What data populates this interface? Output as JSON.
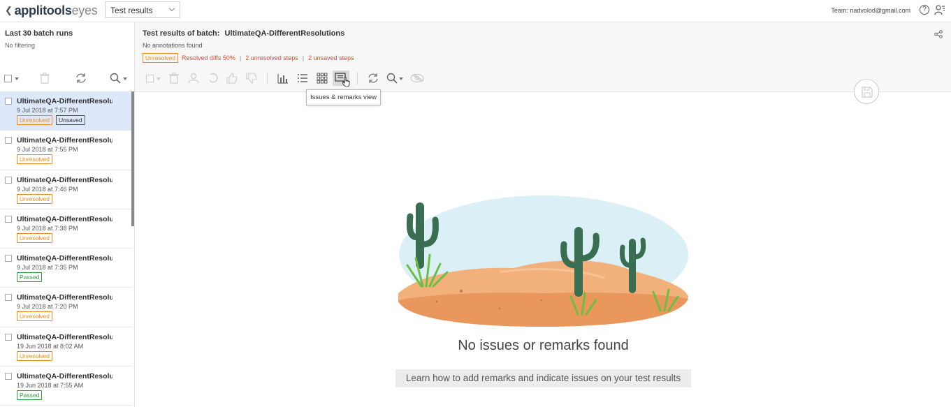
{
  "header": {
    "logo_brand": "applitools",
    "logo_suffix": "eyes",
    "view_select": "Test results",
    "team": "Team: nadvolod@gmail.com"
  },
  "left_panel": {
    "title": "Last 30 batch runs",
    "filter": "No filtering",
    "batches": [
      {
        "name": "UltimateQA-DifferentResolutions",
        "date": "9 Jul 2018 at 7:57 PM",
        "badges": [
          "Unresolved",
          "Unsaved"
        ],
        "selected": true
      },
      {
        "name": "UltimateQA-DifferentResolutions",
        "date": "9 Jul 2018 at 7:55 PM",
        "badges": [
          "Unresolved"
        ]
      },
      {
        "name": "UltimateQA-DifferentResolutions",
        "date": "9 Jul 2018 at 7:46 PM",
        "badges": [
          "Unresolved"
        ]
      },
      {
        "name": "UltimateQA-DifferentResolutions",
        "date": "9 Jul 2018 at 7:38 PM",
        "badges": [
          "Unresolved"
        ]
      },
      {
        "name": "UltimateQA-DifferentResolutions",
        "date": "9 Jul 2018 at 7:35 PM",
        "badges": [
          "Passed"
        ]
      },
      {
        "name": "UltimateQA-DifferentResolutions",
        "date": "9 Jul 2018 at 7:20 PM",
        "badges": [
          "Unresolved"
        ]
      },
      {
        "name": "UltimateQA-DifferentResolutions",
        "date": "19 Jun 2018 at 8:02 AM",
        "badges": [
          "Unresolved"
        ]
      },
      {
        "name": "UltimateQA-DifferentResolutions",
        "date": "19 Jun 2018 at 7:55 AM",
        "badges": [
          "Passed"
        ]
      }
    ]
  },
  "main": {
    "title_prefix": "Test results of batch:",
    "batch_name": "UltimateQA-DifferentResolutions",
    "annotations": "No annotations found",
    "status_badge": "Unresolved",
    "resolved_diffs": "Resolved diffs 50%",
    "unresolved_steps": "2 unresolved steps",
    "unsaved_steps": "2 unsaved steps",
    "separator": "|",
    "tooltip": "Issues & remarks view",
    "empty_title": "No issues or remarks found",
    "learn_button": "Learn how to add remarks and indicate issues on your test results"
  },
  "colors": {
    "unresolved": "#f28a17",
    "passed": "#2e9c3e",
    "status_red": "#e24c2f",
    "selected_row": "#dde8fb"
  }
}
